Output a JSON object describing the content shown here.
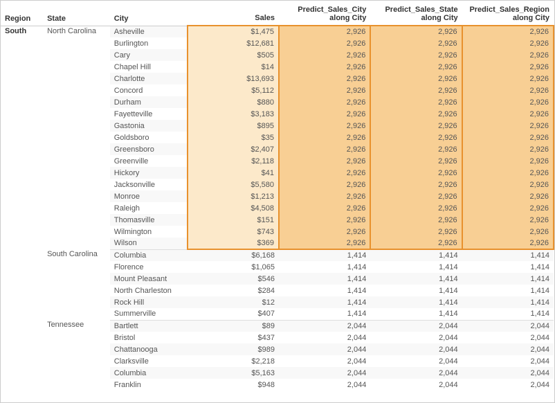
{
  "header": {
    "region": "Region",
    "state": "State",
    "city": "City",
    "sales": "Sales",
    "predict_city": "Predict_Sales_City along City",
    "predict_state": "Predict_Sales_State along City",
    "predict_region": "Predict_Sales_Region along City"
  },
  "region_label": "South",
  "states": [
    {
      "name": "North Carolina",
      "highlight": true,
      "predict": "2,926",
      "cities": [
        {
          "name": "Asheville",
          "sales": "$1,475"
        },
        {
          "name": "Burlington",
          "sales": "$12,681"
        },
        {
          "name": "Cary",
          "sales": "$505"
        },
        {
          "name": "Chapel Hill",
          "sales": "$14"
        },
        {
          "name": "Charlotte",
          "sales": "$13,693"
        },
        {
          "name": "Concord",
          "sales": "$5,112"
        },
        {
          "name": "Durham",
          "sales": "$880"
        },
        {
          "name": "Fayetteville",
          "sales": "$3,183"
        },
        {
          "name": "Gastonia",
          "sales": "$895"
        },
        {
          "name": "Goldsboro",
          "sales": "$35"
        },
        {
          "name": "Greensboro",
          "sales": "$2,407"
        },
        {
          "name": "Greenville",
          "sales": "$2,118"
        },
        {
          "name": "Hickory",
          "sales": "$41"
        },
        {
          "name": "Jacksonville",
          "sales": "$5,580"
        },
        {
          "name": "Monroe",
          "sales": "$1,213"
        },
        {
          "name": "Raleigh",
          "sales": "$4,508"
        },
        {
          "name": "Thomasville",
          "sales": "$151"
        },
        {
          "name": "Wilmington",
          "sales": "$743"
        },
        {
          "name": "Wilson",
          "sales": "$369"
        }
      ]
    },
    {
      "name": "South Carolina",
      "highlight": false,
      "predict": "1,414",
      "cities": [
        {
          "name": "Columbia",
          "sales": "$6,168"
        },
        {
          "name": "Florence",
          "sales": "$1,065"
        },
        {
          "name": "Mount Pleasant",
          "sales": "$546"
        },
        {
          "name": "North Charleston",
          "sales": "$284"
        },
        {
          "name": "Rock Hill",
          "sales": "$12"
        },
        {
          "name": "Summerville",
          "sales": "$407"
        }
      ]
    },
    {
      "name": "Tennessee",
      "highlight": false,
      "predict": "2,044",
      "cities": [
        {
          "name": "Bartlett",
          "sales": "$89"
        },
        {
          "name": "Bristol",
          "sales": "$437"
        },
        {
          "name": "Chattanooga",
          "sales": "$989"
        },
        {
          "name": "Clarksville",
          "sales": "$2,218"
        },
        {
          "name": "Columbia",
          "sales": "$5,163"
        },
        {
          "name": "Franklin",
          "sales": "$948"
        }
      ]
    }
  ]
}
